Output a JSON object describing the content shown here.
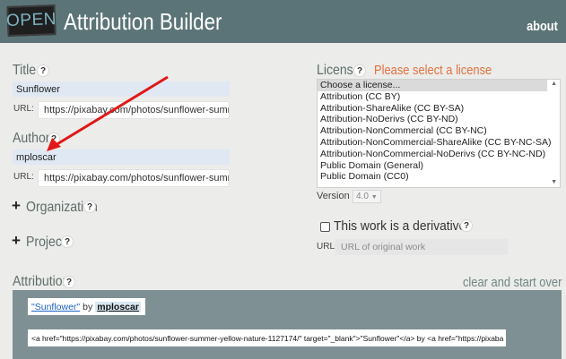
{
  "header": {
    "logo_text": "OPEN",
    "title": "Attribution Builder",
    "about_label": "about"
  },
  "title_field": {
    "label": "Title",
    "value": "Sunflower",
    "url_label": "URL:",
    "url_value": "https://pixabay.com/photos/sunflower-summe"
  },
  "author_field": {
    "label": "Author",
    "value": "mploscar",
    "url_label": "URL:",
    "url_value": "https://pixabay.com/photos/sunflower-summe"
  },
  "organization": {
    "expand": "+",
    "label": "Organization"
  },
  "project": {
    "expand": "+",
    "label": "Project"
  },
  "help_glyph": "?",
  "license": {
    "label": "License",
    "warning": "Please select a license",
    "options": [
      "Choose a license...",
      "Attribution (CC BY)",
      "Attribution-ShareAlike (CC BY-SA)",
      "Attribution-NoDerivs (CC BY-ND)",
      "Attribution-NonCommercial (CC BY-NC)",
      "Attribution-NonCommercial-ShareAlike (CC BY-NC-SA)",
      "Attribution-NonCommercial-NoDerivs (CC BY-NC-ND)",
      "Public Domain (General)",
      "Public Domain (CC0)"
    ],
    "selected": "Choose a license...",
    "version_label": "Version",
    "version_value": "4.0"
  },
  "derivative": {
    "label": "This work is a derivative",
    "url_label": "URL:",
    "url_placeholder": "URL of original work"
  },
  "attribution": {
    "label": "Attribution",
    "clear_label": "clear and start over",
    "preview_title": "\"Sunflower\"",
    "preview_by": "by",
    "preview_author": "mploscar",
    "code": "<a href=\"https://pixabay.com/photos/sunflower-summer-yellow-nature-1127174/\" target=\"_blank\">\"Sunflower\"</a> by <a href=\"https://pixaba"
  },
  "colors": {
    "header_bg": "#5b7478",
    "warning": "#e2713f",
    "arrow": "#e01818",
    "panel": "#7f9094"
  },
  "icons": [
    "open-logo",
    "help-icon",
    "plus-icon",
    "checkbox-icon",
    "chevron-down-icon",
    "red-arrow-annotation"
  ]
}
